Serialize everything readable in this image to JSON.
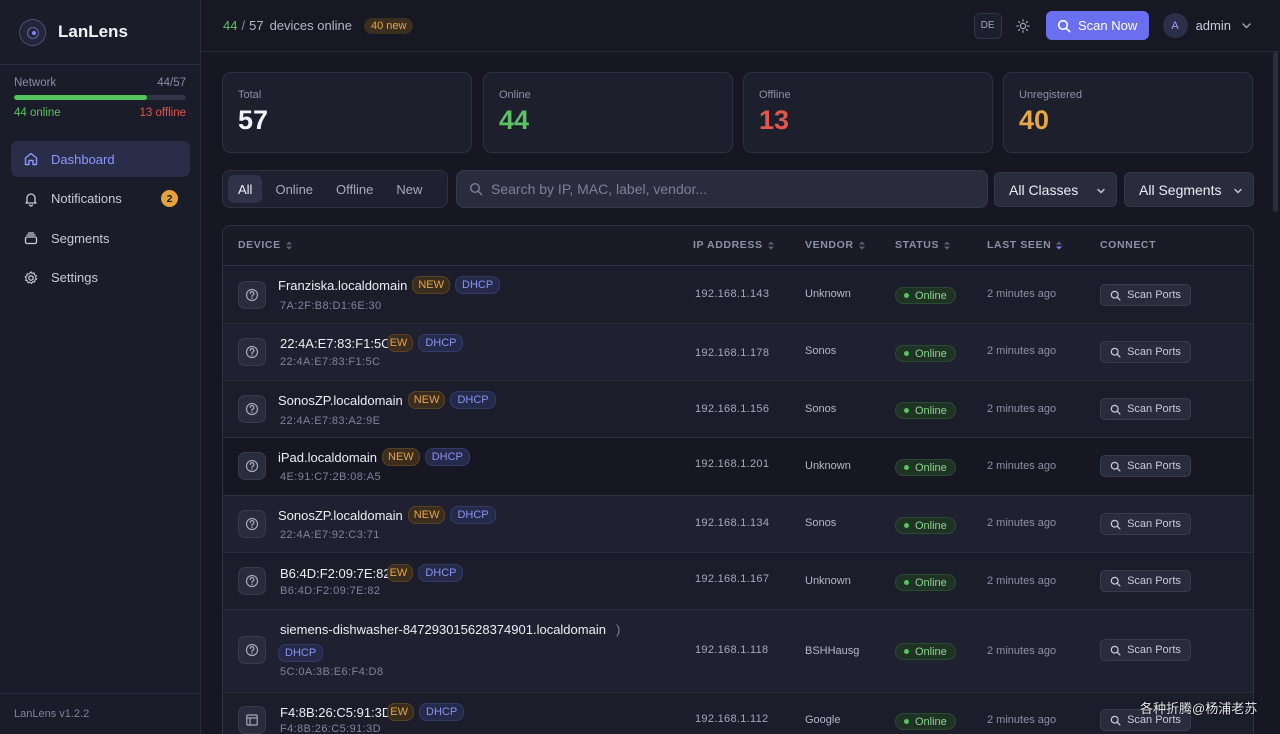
{
  "app": {
    "name": "LanLens",
    "version": "LanLens v1.2.2"
  },
  "network": {
    "label": "Network",
    "ratio": "44/57",
    "online_fraction": 0.772,
    "online_text": "44 online",
    "offline_text": "13 offline"
  },
  "nav": [
    {
      "label": "Dashboard",
      "icon": "home-icon",
      "active": true
    },
    {
      "label": "Notifications",
      "icon": "bell-icon",
      "badge": "2"
    },
    {
      "label": "Segments",
      "icon": "segments-icon"
    },
    {
      "label": "Settings",
      "icon": "gear-icon"
    }
  ],
  "topbar": {
    "online": "44",
    "slash": "/",
    "total": "57",
    "label": "devices online",
    "new_pill": "40 new",
    "lang": "DE",
    "scan_now": "Scan Now",
    "user": "admin",
    "avatar": "A"
  },
  "stats": [
    {
      "label": "Total",
      "value": "57",
      "color": "#f2f3f8"
    },
    {
      "label": "Online",
      "value": "44",
      "color": "#5cc163"
    },
    {
      "label": "Offline",
      "value": "13",
      "color": "#e2574c"
    },
    {
      "label": "Unregistered",
      "value": "40",
      "color": "#e6a548"
    }
  ],
  "filters": {
    "tabs": [
      "All",
      "Online",
      "Offline",
      "New"
    ],
    "search_placeholder": "Search by IP, MAC, label, vendor...",
    "classes": "All Classes",
    "segments": "All Segments"
  },
  "table": {
    "columns": [
      "DEVICE",
      "IP ADDRESS",
      "VENDOR",
      "STATUS",
      "LAST SEEN",
      "CONNECT"
    ],
    "rows": [
      {
        "name": "Franziska.localdomain",
        "new": "NEW",
        "dhcp": "DHCP",
        "mac": "7A:2F:B8:D1:6E:30",
        "ip": "192.168.1.143",
        "vendor": "Unknown",
        "status": "Online",
        "seen": "2 minutes ago",
        "action": "Scan Ports",
        "icon": "question-icon"
      },
      {
        "name": "22:4A:E7:83:F1:5C",
        "new": "EW",
        "dhcp": "DHCP",
        "mac": "22:4A:E7:83:F1:5C",
        "ip": "192.168.1.178",
        "vendor": "Sonos",
        "status": "Online",
        "seen": "2 minutes ago",
        "action": "Scan Ports",
        "icon": "question-icon"
      },
      {
        "name": "SonosZP.localdomain",
        "new": "NEW",
        "dhcp": "DHCP",
        "mac": "22:4A:E7:83:A2:9E",
        "ip": "192.168.1.156",
        "vendor": "Sonos",
        "status": "Online",
        "seen": "2 minutes ago",
        "action": "Scan Ports",
        "icon": "question-icon"
      },
      {
        "name": "iPad.localdomain",
        "new": "NEW",
        "dhcp": "DHCP",
        "mac": "4E:91:C7:2B:08:A5",
        "ip": "192.168.1.201",
        "vendor": "Unknown",
        "status": "Online",
        "seen": "2 minutes ago",
        "action": "Scan Ports",
        "icon": "question-icon"
      },
      {
        "name": "SonosZP.localdomain",
        "new": "NEW",
        "dhcp": "DHCP",
        "mac": "22:4A:E7:92:C3:71",
        "ip": "192.168.1.134",
        "vendor": "Sonos",
        "status": "Online",
        "seen": "2 minutes ago",
        "action": "Scan Ports",
        "icon": "question-icon"
      },
      {
        "name": "B6:4D:F2:09:7E:82",
        "new": "EW",
        "dhcp": "DHCP",
        "mac": "B6:4D:F2:09:7E:82",
        "ip": "192.168.1.167",
        "vendor": "Unknown",
        "status": "Online",
        "seen": "2 minutes ago",
        "action": "Scan Ports",
        "icon": "question-icon"
      },
      {
        "name": "siemens-dishwasher-847293015628374901.localdomain",
        "new": ")",
        "dhcp": "DHCP",
        "mac": "5C:0A:3B:E6:F4:D8",
        "ip": "192.168.1.118",
        "vendor": "BSHHausg",
        "status": "Online",
        "seen": "2 minutes ago",
        "action": "Scan Ports",
        "icon": "question-icon"
      },
      {
        "name": "F4:8B:26:C5:91:3D",
        "new": "EW",
        "dhcp": "DHCP",
        "mac": "F4:8B:26:C5:91:3D",
        "ip": "192.168.1.112",
        "vendor": "Google",
        "status": "Online",
        "seen": "2 minutes ago",
        "action": "Scan Ports",
        "icon": "tv-icon"
      }
    ]
  },
  "watermark": "各种折腾@杨浦老苏"
}
